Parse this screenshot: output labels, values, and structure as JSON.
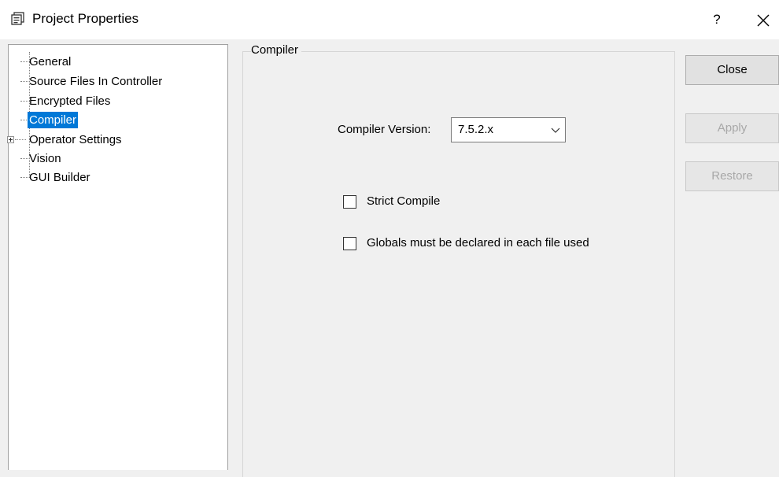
{
  "window": {
    "title": "Project Properties",
    "help_label": "?"
  },
  "tree": {
    "items": [
      {
        "label": "General",
        "selected": false,
        "expandable": false
      },
      {
        "label": "Source Files In Controller",
        "selected": false,
        "expandable": false
      },
      {
        "label": "Encrypted Files",
        "selected": false,
        "expandable": false
      },
      {
        "label": "Compiler",
        "selected": true,
        "expandable": false
      },
      {
        "label": "Operator Settings",
        "selected": false,
        "expandable": true
      },
      {
        "label": "Vision",
        "selected": false,
        "expandable": false
      },
      {
        "label": "GUI Builder",
        "selected": false,
        "expandable": false
      }
    ]
  },
  "compiler": {
    "group_title": "Compiler",
    "version_label": "Compiler Version:",
    "version_value": "7.5.2.x",
    "strict_compile_label": "Strict Compile",
    "strict_compile_checked": false,
    "globals_label": "Globals must be declared in each file used",
    "globals_checked": false
  },
  "buttons": {
    "close": "Close",
    "apply": "Apply",
    "restore": "Restore"
  },
  "colors": {
    "selection": "#0078d7",
    "panel_bg": "#f0f0f0"
  }
}
